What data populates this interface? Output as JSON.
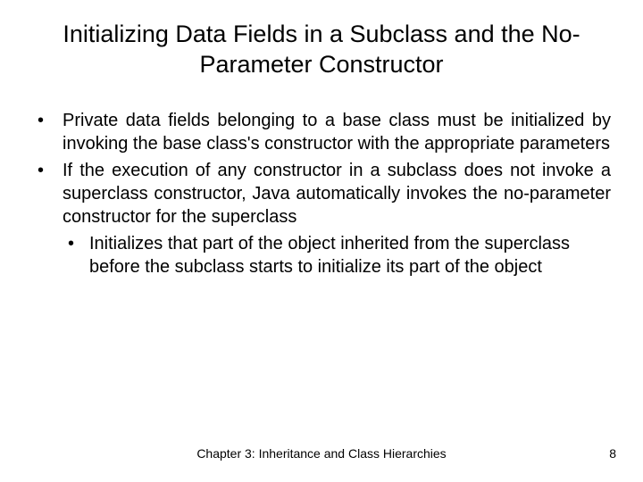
{
  "title": "Initializing Data Fields in a Subclass and the No-Parameter Constructor",
  "bullets": {
    "b1": "Private data fields belonging to a base class must be initialized by invoking the base class's constructor with the appropriate parameters",
    "b2": "If the execution of any constructor in a subclass does not invoke a superclass constructor, Java automatically invokes the no-parameter constructor for the superclass",
    "b2_sub1": "Initializes that part of the object inherited from the superclass before the subclass starts to initialize its part of the object"
  },
  "footer": {
    "chapter": "Chapter 3: Inheritance and Class Hierarchies",
    "page": "8"
  }
}
